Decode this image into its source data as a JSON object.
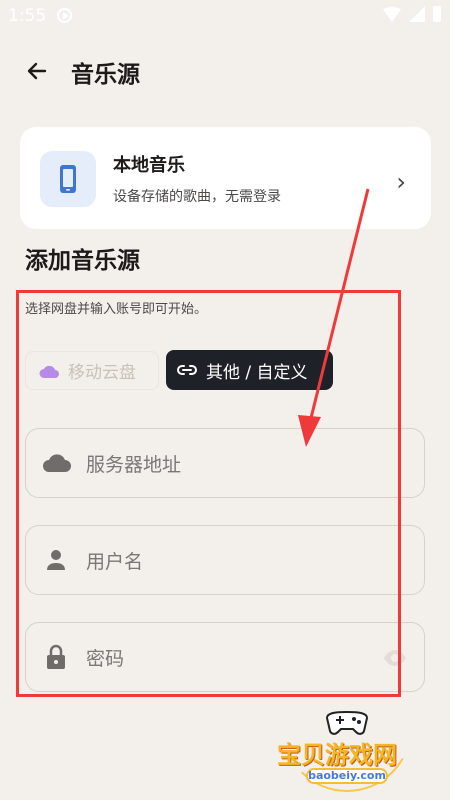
{
  "status_bar": {
    "time": "1:55"
  },
  "header": {
    "title": "音乐源"
  },
  "local_source": {
    "title": "本地音乐",
    "subtitle": "设备存储的歌曲，无需登录"
  },
  "add_source": {
    "title": "添加音乐源",
    "hint": "选择网盘并输入账号即可开始。",
    "chips": [
      {
        "label": "移动云盘",
        "state": "disabled"
      },
      {
        "label": "其他 / 自定义",
        "state": "selected"
      }
    ],
    "fields": {
      "server": {
        "placeholder": "服务器地址"
      },
      "username": {
        "placeholder": "用户名"
      },
      "password": {
        "placeholder": "密码"
      }
    }
  },
  "watermark": {
    "brand": "宝贝游戏网",
    "url": "baobeiy.com"
  },
  "colors": {
    "background": "#f3efeb",
    "card": "#ffffff",
    "selected_chip": "#1f2128",
    "annotation": "#ef3a3a",
    "icon_blue": "#4176ce"
  },
  "icons": [
    "back-arrow-icon",
    "phone-icon",
    "chevron-right-icon",
    "cloud-icon",
    "link-icon",
    "user-icon",
    "lock-icon",
    "eye-icon"
  ]
}
